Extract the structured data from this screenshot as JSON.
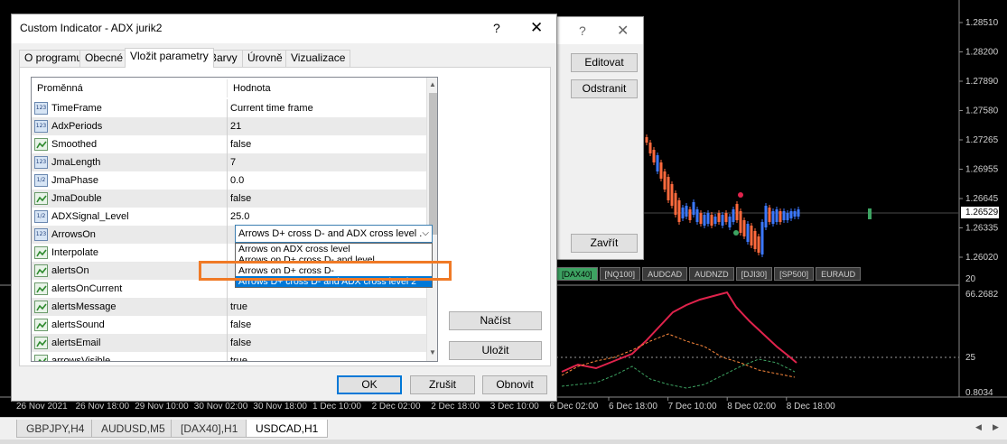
{
  "chart": {
    "window_label": "USDCAD,H1",
    "price_ticks": [
      "1.28510",
      "1.28200",
      "1.27890",
      "1.27580",
      "1.27265",
      "1.26955",
      "1.26645",
      "1.26335",
      "1.26020"
    ],
    "current_price": "1.26529",
    "indicator_ticks": [
      "20",
      "66.2682",
      "25",
      "0.8034"
    ],
    "time_ticks": [
      "26 Nov 2021",
      "26 Nov 18:00",
      "29 Nov 10:00",
      "30 Nov 02:00",
      "30 Nov 18:00",
      "1 Dec 10:00",
      "2 Dec 02:00",
      "2 Dec 18:00",
      "3 Dec 10:00",
      "6 Dec 02:00",
      "6 Dec 18:00",
      "7 Dec 10:00",
      "8 Dec 02:00",
      "8 Dec 18:00"
    ],
    "symbol_buttons": [
      "[DAX40]",
      "[NQ100]",
      "AUDCAD",
      "AUDNZD",
      "[DJI30]",
      "[SP500]",
      "EURAUD"
    ],
    "active_symbol": "[DAX40]",
    "colors": {
      "bull": "#3b78ff",
      "bear": "#ff6a3d",
      "signal_up": "#3da362",
      "signal_down": "#e0234c",
      "adx_line": "#e0234c",
      "dplus": "#ff8a3d",
      "dminus": "#3da362"
    }
  },
  "chart_tabs": [
    "GBPJPY,H4",
    "AUDUSD,M5",
    "[DAX40],H1",
    "USDCAD,H1"
  ],
  "active_chart_tab": "USDCAD,H1",
  "background_dialog": {
    "help": "?",
    "close": "✕",
    "buttons": [
      "Editovat",
      "Odstranit",
      "Zavřít"
    ]
  },
  "dialog": {
    "title": "Custom Indicator - ADX jurik2",
    "help": "?",
    "close": "✕",
    "tabs": [
      "O programu",
      "Obecné",
      "Vložit parametry",
      "Barvy",
      "Úrovně",
      "Vizualizace"
    ],
    "active_tab": "Vložit parametry",
    "columns": [
      "Proměnná",
      "Hodnota"
    ],
    "params": [
      {
        "icon": "123",
        "name": "TimeFrame",
        "value": "Current time frame"
      },
      {
        "icon": "123",
        "name": "AdxPeriods",
        "value": "21"
      },
      {
        "icon": "bool",
        "name": "Smoothed",
        "value": "false"
      },
      {
        "icon": "123",
        "name": "JmaLength",
        "value": "7"
      },
      {
        "icon": "1/2",
        "name": "JmaPhase",
        "value": "0.0"
      },
      {
        "icon": "bool",
        "name": "JmaDouble",
        "value": "false"
      },
      {
        "icon": "1/2",
        "name": "ADXSignal_Level",
        "value": "25.0"
      },
      {
        "icon": "123",
        "name": "ArrowsOn",
        "value": ""
      },
      {
        "icon": "bool",
        "name": "Interpolate",
        "value": ""
      },
      {
        "icon": "bool",
        "name": "alertsOn",
        "value": ""
      },
      {
        "icon": "bool",
        "name": "alertsOnCurrent",
        "value": ""
      },
      {
        "icon": "bool",
        "name": "alertsMessage",
        "value": "true"
      },
      {
        "icon": "bool",
        "name": "alertsSound",
        "value": "false"
      },
      {
        "icon": "bool",
        "name": "alertsEmail",
        "value": "false"
      },
      {
        "icon": "bool",
        "name": "arrowsVisible",
        "value": "true"
      }
    ],
    "combo_value": "Arrows D+ cross D- and ADX cross level .",
    "dropdown_options": [
      "Arrows on ADX cross level",
      "Arrows on D+ cross D- and level",
      "Arrows on D+ cross D-",
      "Arrows D+ cross D- and ADX cross level 2"
    ],
    "dropdown_selected_index": 3,
    "side_buttons": {
      "load": "Načíst",
      "save": "Uložit"
    },
    "bottom_buttons": {
      "ok": "OK",
      "cancel": "Zrušit",
      "reset": "Obnovit"
    }
  }
}
